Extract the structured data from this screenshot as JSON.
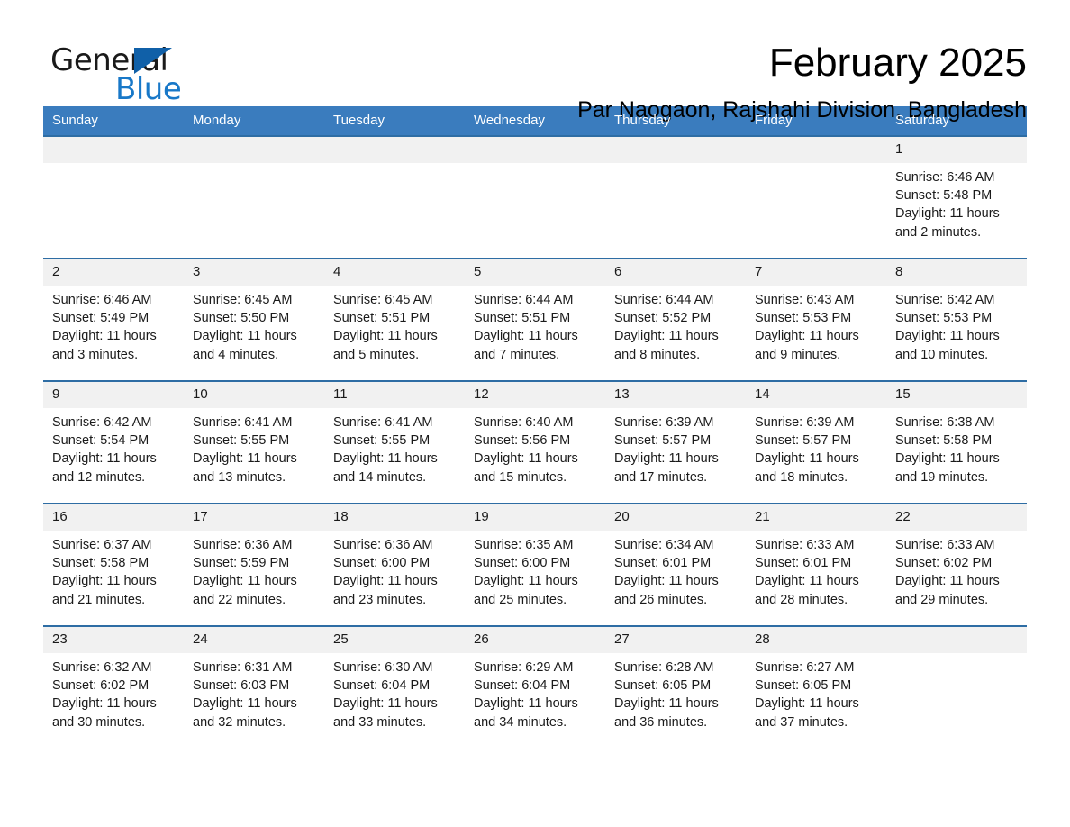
{
  "brand": {
    "word_one": "General",
    "word_two": "Blue",
    "triangle_color": "#1060a8",
    "blue_color": "#1878c8",
    "logo_icon": "general-blue-triangle-logo"
  },
  "header": {
    "title": "February 2025",
    "location": "Par Naogaon, Rajshahi Division, Bangladesh"
  },
  "theme": {
    "header_row_bg": "#3a7cbe",
    "row_divider": "#2e6da4",
    "daynum_bg": "#f1f1f1",
    "text": "#1a1a1a"
  },
  "calendar": {
    "weekday_headers": [
      "Sunday",
      "Monday",
      "Tuesday",
      "Wednesday",
      "Thursday",
      "Friday",
      "Saturday"
    ],
    "labels": {
      "sunrise": "Sunrise:",
      "sunset": "Sunset:",
      "daylight": "Daylight:"
    },
    "weeks": [
      [
        {
          "blank": true
        },
        {
          "blank": true
        },
        {
          "blank": true
        },
        {
          "blank": true
        },
        {
          "blank": true
        },
        {
          "blank": true
        },
        {
          "day": "1",
          "sunrise": "Sunrise: 6:46 AM",
          "sunset": "Sunset: 5:48 PM",
          "daylight": "Daylight: 11 hours and 2 minutes."
        }
      ],
      [
        {
          "day": "2",
          "sunrise": "Sunrise: 6:46 AM",
          "sunset": "Sunset: 5:49 PM",
          "daylight": "Daylight: 11 hours and 3 minutes."
        },
        {
          "day": "3",
          "sunrise": "Sunrise: 6:45 AM",
          "sunset": "Sunset: 5:50 PM",
          "daylight": "Daylight: 11 hours and 4 minutes."
        },
        {
          "day": "4",
          "sunrise": "Sunrise: 6:45 AM",
          "sunset": "Sunset: 5:51 PM",
          "daylight": "Daylight: 11 hours and 5 minutes."
        },
        {
          "day": "5",
          "sunrise": "Sunrise: 6:44 AM",
          "sunset": "Sunset: 5:51 PM",
          "daylight": "Daylight: 11 hours and 7 minutes."
        },
        {
          "day": "6",
          "sunrise": "Sunrise: 6:44 AM",
          "sunset": "Sunset: 5:52 PM",
          "daylight": "Daylight: 11 hours and 8 minutes."
        },
        {
          "day": "7",
          "sunrise": "Sunrise: 6:43 AM",
          "sunset": "Sunset: 5:53 PM",
          "daylight": "Daylight: 11 hours and 9 minutes."
        },
        {
          "day": "8",
          "sunrise": "Sunrise: 6:42 AM",
          "sunset": "Sunset: 5:53 PM",
          "daylight": "Daylight: 11 hours and 10 minutes."
        }
      ],
      [
        {
          "day": "9",
          "sunrise": "Sunrise: 6:42 AM",
          "sunset": "Sunset: 5:54 PM",
          "daylight": "Daylight: 11 hours and 12 minutes."
        },
        {
          "day": "10",
          "sunrise": "Sunrise: 6:41 AM",
          "sunset": "Sunset: 5:55 PM",
          "daylight": "Daylight: 11 hours and 13 minutes."
        },
        {
          "day": "11",
          "sunrise": "Sunrise: 6:41 AM",
          "sunset": "Sunset: 5:55 PM",
          "daylight": "Daylight: 11 hours and 14 minutes."
        },
        {
          "day": "12",
          "sunrise": "Sunrise: 6:40 AM",
          "sunset": "Sunset: 5:56 PM",
          "daylight": "Daylight: 11 hours and 15 minutes."
        },
        {
          "day": "13",
          "sunrise": "Sunrise: 6:39 AM",
          "sunset": "Sunset: 5:57 PM",
          "daylight": "Daylight: 11 hours and 17 minutes."
        },
        {
          "day": "14",
          "sunrise": "Sunrise: 6:39 AM",
          "sunset": "Sunset: 5:57 PM",
          "daylight": "Daylight: 11 hours and 18 minutes."
        },
        {
          "day": "15",
          "sunrise": "Sunrise: 6:38 AM",
          "sunset": "Sunset: 5:58 PM",
          "daylight": "Daylight: 11 hours and 19 minutes."
        }
      ],
      [
        {
          "day": "16",
          "sunrise": "Sunrise: 6:37 AM",
          "sunset": "Sunset: 5:58 PM",
          "daylight": "Daylight: 11 hours and 21 minutes."
        },
        {
          "day": "17",
          "sunrise": "Sunrise: 6:36 AM",
          "sunset": "Sunset: 5:59 PM",
          "daylight": "Daylight: 11 hours and 22 minutes."
        },
        {
          "day": "18",
          "sunrise": "Sunrise: 6:36 AM",
          "sunset": "Sunset: 6:00 PM",
          "daylight": "Daylight: 11 hours and 23 minutes."
        },
        {
          "day": "19",
          "sunrise": "Sunrise: 6:35 AM",
          "sunset": "Sunset: 6:00 PM",
          "daylight": "Daylight: 11 hours and 25 minutes."
        },
        {
          "day": "20",
          "sunrise": "Sunrise: 6:34 AM",
          "sunset": "Sunset: 6:01 PM",
          "daylight": "Daylight: 11 hours and 26 minutes."
        },
        {
          "day": "21",
          "sunrise": "Sunrise: 6:33 AM",
          "sunset": "Sunset: 6:01 PM",
          "daylight": "Daylight: 11 hours and 28 minutes."
        },
        {
          "day": "22",
          "sunrise": "Sunrise: 6:33 AM",
          "sunset": "Sunset: 6:02 PM",
          "daylight": "Daylight: 11 hours and 29 minutes."
        }
      ],
      [
        {
          "day": "23",
          "sunrise": "Sunrise: 6:32 AM",
          "sunset": "Sunset: 6:02 PM",
          "daylight": "Daylight: 11 hours and 30 minutes."
        },
        {
          "day": "24",
          "sunrise": "Sunrise: 6:31 AM",
          "sunset": "Sunset: 6:03 PM",
          "daylight": "Daylight: 11 hours and 32 minutes."
        },
        {
          "day": "25",
          "sunrise": "Sunrise: 6:30 AM",
          "sunset": "Sunset: 6:04 PM",
          "daylight": "Daylight: 11 hours and 33 minutes."
        },
        {
          "day": "26",
          "sunrise": "Sunrise: 6:29 AM",
          "sunset": "Sunset: 6:04 PM",
          "daylight": "Daylight: 11 hours and 34 minutes."
        },
        {
          "day": "27",
          "sunrise": "Sunrise: 6:28 AM",
          "sunset": "Sunset: 6:05 PM",
          "daylight": "Daylight: 11 hours and 36 minutes."
        },
        {
          "day": "28",
          "sunrise": "Sunrise: 6:27 AM",
          "sunset": "Sunset: 6:05 PM",
          "daylight": "Daylight: 11 hours and 37 minutes."
        },
        {
          "blank": true
        }
      ]
    ]
  }
}
